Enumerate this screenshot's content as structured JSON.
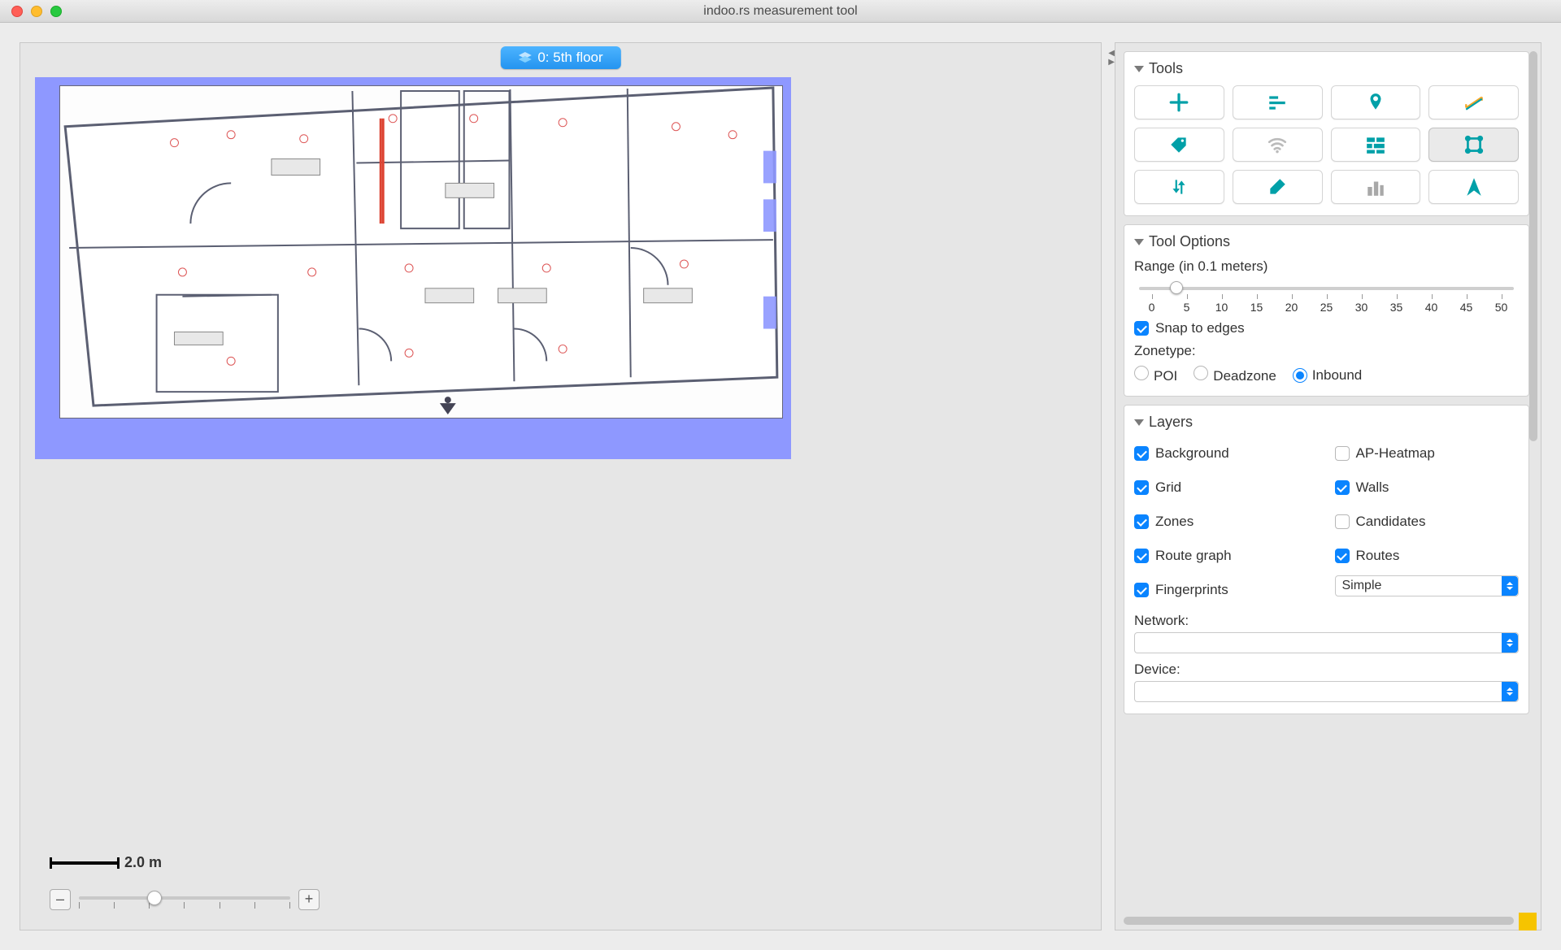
{
  "window": {
    "title": "indoo.rs measurement tool"
  },
  "floor": {
    "label": "0: 5th floor"
  },
  "scale": {
    "label": "2.0 m"
  },
  "zoom": {
    "minus": "–",
    "plus": "+"
  },
  "panels": {
    "tools": {
      "title": "Tools"
    },
    "toolOptions": {
      "title": "Tool Options",
      "rangeLabel": "Range (in 0.1 meters)",
      "ticks": [
        "0",
        "5",
        "10",
        "15",
        "20",
        "25",
        "30",
        "35",
        "40",
        "45",
        "50"
      ],
      "snapLabel": "Snap to edges",
      "snapChecked": true,
      "zonetypeLabel": "Zonetype:",
      "zonetypes": {
        "poi": {
          "label": "POI",
          "selected": false
        },
        "dead": {
          "label": "Deadzone",
          "selected": false
        },
        "inb": {
          "label": "Inbound",
          "selected": true
        }
      }
    },
    "layers": {
      "title": "Layers",
      "items": {
        "background": {
          "label": "Background",
          "checked": true
        },
        "apheat": {
          "label": "AP-Heatmap",
          "checked": false
        },
        "grid": {
          "label": "Grid",
          "checked": true
        },
        "walls": {
          "label": "Walls",
          "checked": true
        },
        "zones": {
          "label": "Zones",
          "checked": true
        },
        "candidates": {
          "label": "Candidates",
          "checked": false
        },
        "routegraph": {
          "label": "Route graph",
          "checked": true
        },
        "routes": {
          "label": "Routes",
          "checked": true
        },
        "fingerprints": {
          "label": "Fingerprints",
          "checked": true
        }
      },
      "fingerprintsMode": "Simple",
      "networkLabel": "Network:",
      "networkValue": "",
      "deviceLabel": "Device:",
      "deviceValue": ""
    }
  },
  "toolIcons": [
    "move",
    "align",
    "pin",
    "measure",
    "tag",
    "wifi",
    "wall",
    "crop",
    "swap",
    "erase",
    "city",
    "nav"
  ]
}
